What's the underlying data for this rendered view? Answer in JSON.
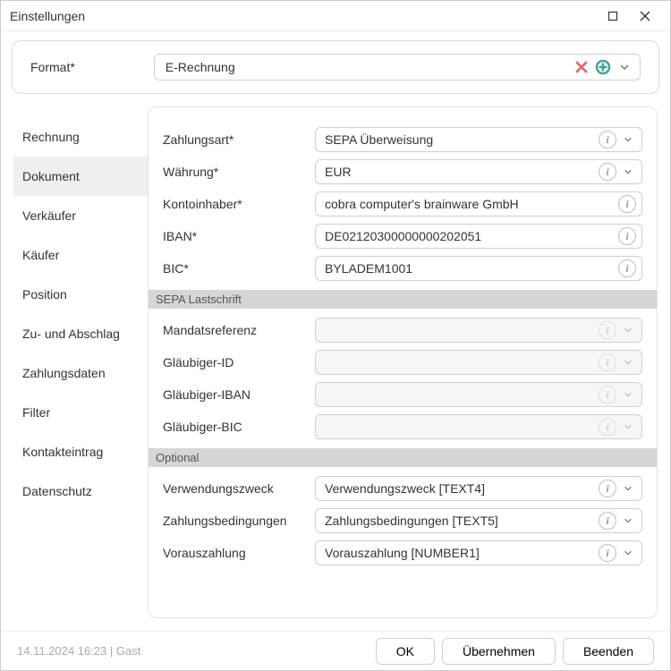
{
  "window": {
    "title": "Einstellungen"
  },
  "format": {
    "label": "Format*",
    "value": "E-Rechnung"
  },
  "sidebar": {
    "items": [
      {
        "label": "Rechnung"
      },
      {
        "label": "Dokument"
      },
      {
        "label": "Verkäufer"
      },
      {
        "label": "Käufer"
      },
      {
        "label": "Position"
      },
      {
        "label": "Zu- und Abschlag"
      },
      {
        "label": "Zahlungsdaten"
      },
      {
        "label": "Filter"
      },
      {
        "label": "Kontakteintrag"
      },
      {
        "label": "Datenschutz"
      }
    ],
    "activeIndex": 1
  },
  "form": {
    "zahlungsart": {
      "label": "Zahlungsart*",
      "value": "SEPA Überweisung"
    },
    "waehrung": {
      "label": "Währung*",
      "value": "EUR"
    },
    "kontoinhaber": {
      "label": "Kontoinhaber*",
      "value": "cobra computer's brainware GmbH"
    },
    "iban": {
      "label": "IBAN*",
      "value": "DE02120300000000202051"
    },
    "bic": {
      "label": "BIC*",
      "value": "BYLADEM1001"
    },
    "section_sepa": "SEPA Lastschrift",
    "mandatsreferenz": {
      "label": "Mandatsreferenz",
      "value": ""
    },
    "glaeubiger_id": {
      "label": "Gläubiger-ID",
      "value": ""
    },
    "glaeubiger_iban": {
      "label": "Gläubiger-IBAN",
      "value": ""
    },
    "glaeubiger_bic": {
      "label": "Gläubiger-BIC",
      "value": ""
    },
    "section_optional": "Optional",
    "verwendungszweck": {
      "label": "Verwendungszweck",
      "value": "Verwendungszweck [TEXT4]"
    },
    "zahlungsbedingungen": {
      "label": "Zahlungsbedingungen",
      "value": "Zahlungsbedingungen [TEXT5]"
    },
    "vorauszahlung": {
      "label": "Vorauszahlung",
      "value": "Vorauszahlung [NUMBER1]"
    }
  },
  "footer": {
    "status": "14.11.2024 16:23 | Gast",
    "ok": "OK",
    "apply": "Übernehmen",
    "close": "Beenden"
  }
}
